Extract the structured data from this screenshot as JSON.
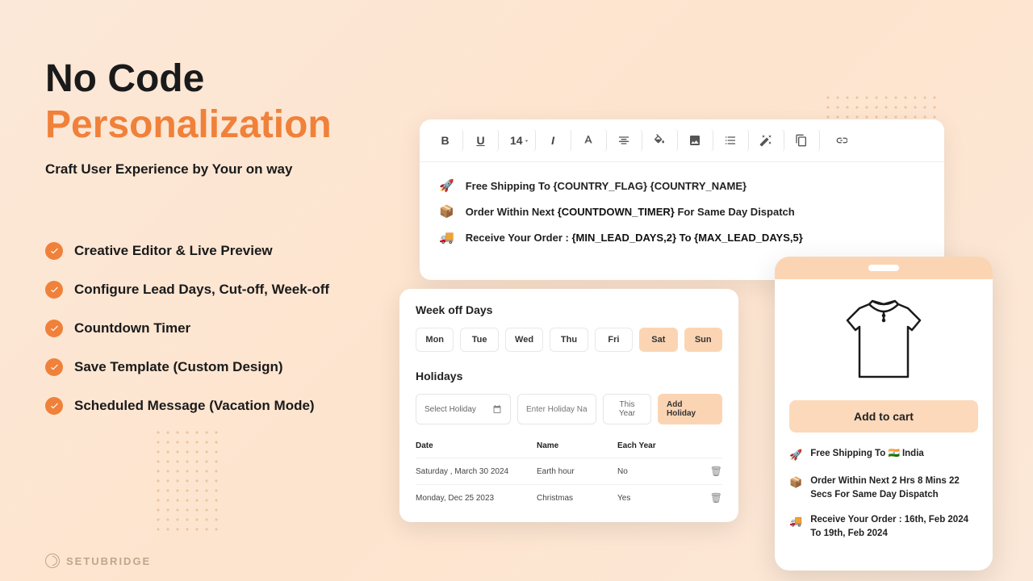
{
  "heading": {
    "line1": "No Code",
    "line2": "Personalization",
    "subtitle": "Craft User Experience by Your on way"
  },
  "features": [
    "Creative Editor & Live Preview",
    "Configure Lead Days, Cut-off, Week-off",
    "Countdown Timer",
    "Save Template (Custom Design)",
    "Scheduled Message (Vacation Mode)"
  ],
  "brand": "SETUBRIDGE",
  "toolbar": {
    "font_size": "14"
  },
  "editor_lines": [
    {
      "icon": "🚀",
      "text": "Free Shipping To {COUNTRY_FLAG} {COUNTRY_NAME}"
    },
    {
      "icon": "📦",
      "prefix": "Order Within Next ",
      "bold": "{COUNTDOWN_TIMER}",
      "suffix": " For Same Day Dispatch"
    },
    {
      "icon": "🚚",
      "prefix": "Receive Your Order :  ",
      "bold": "{MIN_LEAD_DAYS,2} To  {MAX_LEAD_DAYS,5}"
    }
  ],
  "weekoff": {
    "title": "Week off Days",
    "days": [
      {
        "label": "Mon",
        "selected": false
      },
      {
        "label": "Tue",
        "selected": false
      },
      {
        "label": "Wed",
        "selected": false
      },
      {
        "label": "Thu",
        "selected": false
      },
      {
        "label": "Fri",
        "selected": false
      },
      {
        "label": "Sat",
        "selected": true
      },
      {
        "label": "Sun",
        "selected": true
      }
    ]
  },
  "holidays": {
    "title": "Holidays",
    "select_placeholder": "Select Holiday",
    "name_placeholder": "Enter Holiday Name",
    "year_label": "This Year",
    "add_label": "Add Holiday",
    "headers": {
      "date": "Date",
      "name": "Name",
      "each": "Each Year"
    },
    "rows": [
      {
        "date": "Saturday , March 30 2024",
        "name": "Earth hour",
        "each": "No"
      },
      {
        "date": "Monday, Dec  25  2023",
        "name": "Christmas",
        "each": "Yes"
      }
    ]
  },
  "phone": {
    "add_to_cart": "Add to cart",
    "lines": [
      {
        "icon": "🚀",
        "text": "Free Shipping To  🇮🇳  India"
      },
      {
        "icon": "📦",
        "prefix": "Order Within Next ",
        "bold": "2 Hrs 8 Mins 22 Secs",
        "suffix": " For Same Day Dispatch"
      },
      {
        "icon": "🚚",
        "prefix": "Receive Your Order :  ",
        "bold": "16th, Feb 2024 To 19th, Feb 2024"
      }
    ]
  }
}
